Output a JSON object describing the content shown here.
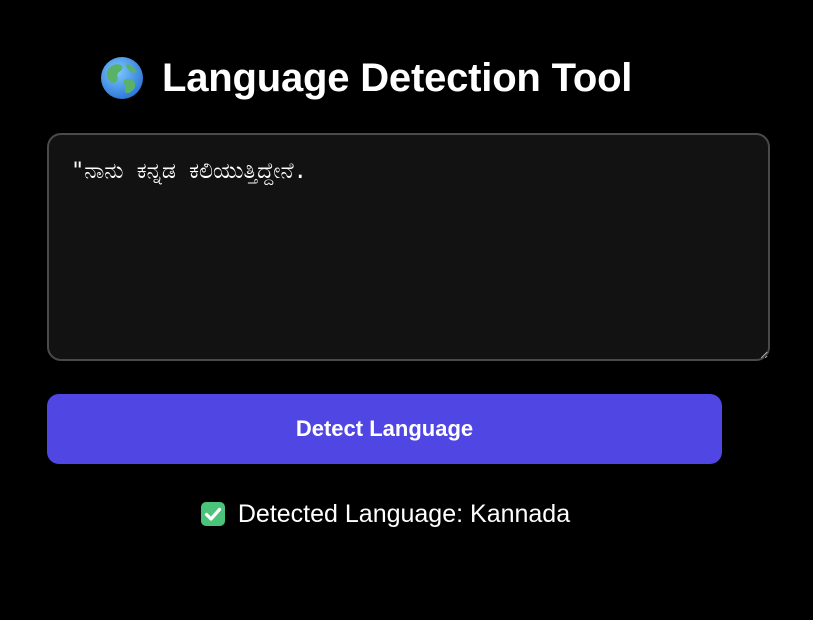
{
  "header": {
    "icon": "globe-icon",
    "title": "Language Detection Tool"
  },
  "input": {
    "value": "\"ನಾನು ಕನ್ನಡ ಕಲಿಯುತ್ತಿದ್ದೇನೆ."
  },
  "actions": {
    "detect_label": "Detect Language"
  },
  "result": {
    "icon": "check-mark-icon",
    "prefix": "Detected Language: ",
    "language": "Kannada"
  },
  "colors": {
    "background": "#000000",
    "textarea_bg": "#121212",
    "textarea_border": "#4a4a4a",
    "button": "#5046e4",
    "check": "#4cc37a"
  }
}
